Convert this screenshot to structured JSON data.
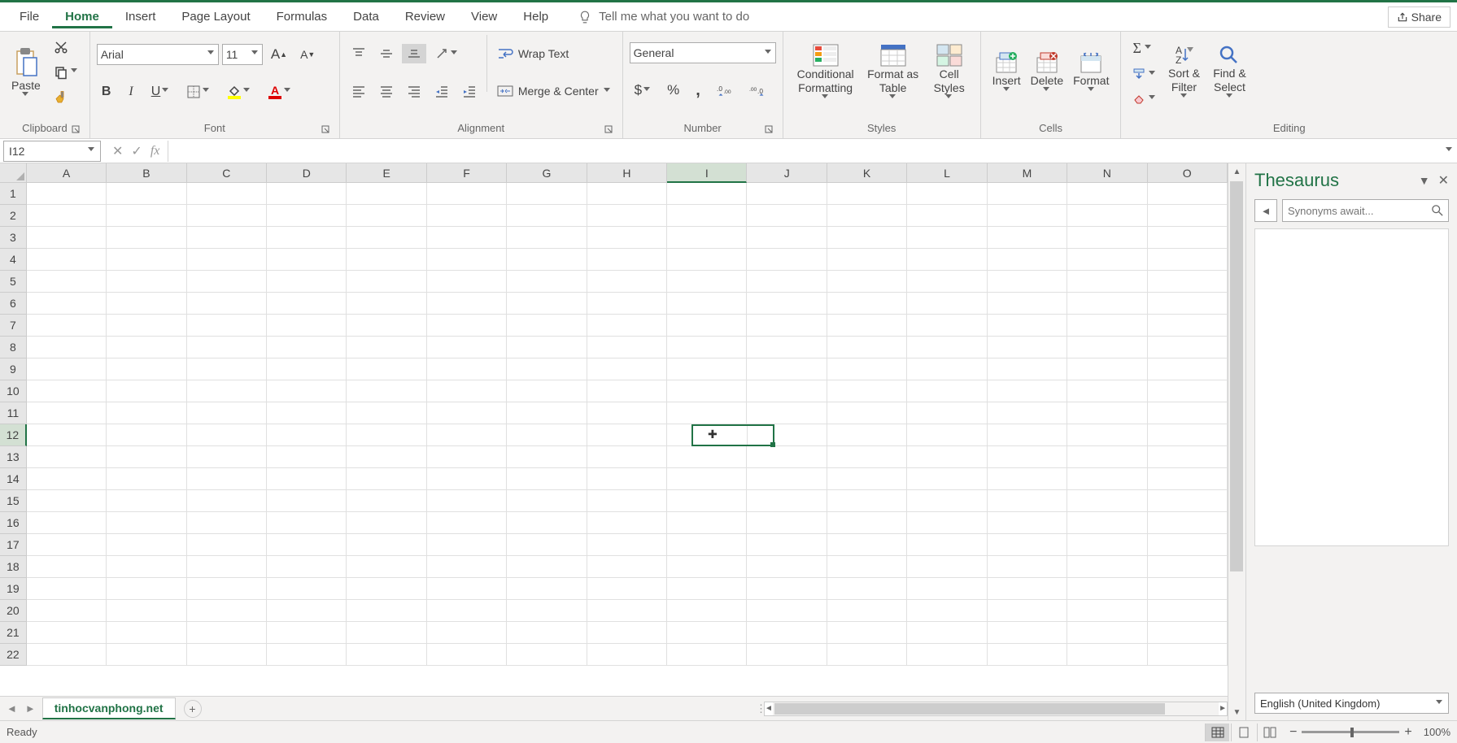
{
  "menubar": {
    "tabs": [
      "File",
      "Home",
      "Insert",
      "Page Layout",
      "Formulas",
      "Data",
      "Review",
      "View",
      "Help"
    ],
    "active": "Home",
    "tellme": "Tell me what you want to do",
    "share": "Share"
  },
  "ribbon": {
    "clipboard": {
      "paste": "Paste",
      "label": "Clipboard"
    },
    "font": {
      "name": "Arial",
      "size": "11",
      "label": "Font",
      "bold": "B",
      "italic": "I",
      "underline": "U"
    },
    "alignment": {
      "wrap": "Wrap Text",
      "merge": "Merge & Center",
      "label": "Alignment"
    },
    "number": {
      "format": "General",
      "label": "Number"
    },
    "styles": {
      "cond": "Conditional Formatting",
      "table": "Format as Table",
      "cell": "Cell Styles",
      "label": "Styles"
    },
    "cells": {
      "insert": "Insert",
      "delete": "Delete",
      "format": "Format",
      "label": "Cells"
    },
    "editing": {
      "sort": "Sort & Filter",
      "find": "Find & Select",
      "label": "Editing"
    }
  },
  "formula_bar": {
    "namebox": "I12",
    "fx": "fx"
  },
  "grid": {
    "columns": [
      "A",
      "B",
      "C",
      "D",
      "E",
      "F",
      "G",
      "H",
      "I",
      "J",
      "K",
      "L",
      "M",
      "N",
      "O"
    ],
    "rows": 22,
    "selected_col": "I",
    "selected_row": 12
  },
  "panel": {
    "title": "Thesaurus",
    "placeholder": "Synonyms await...",
    "language": "English (United Kingdom)"
  },
  "tabs": {
    "sheet": "tinhocvanphong.net"
  },
  "status": {
    "ready": "Ready",
    "zoom": "100%"
  }
}
